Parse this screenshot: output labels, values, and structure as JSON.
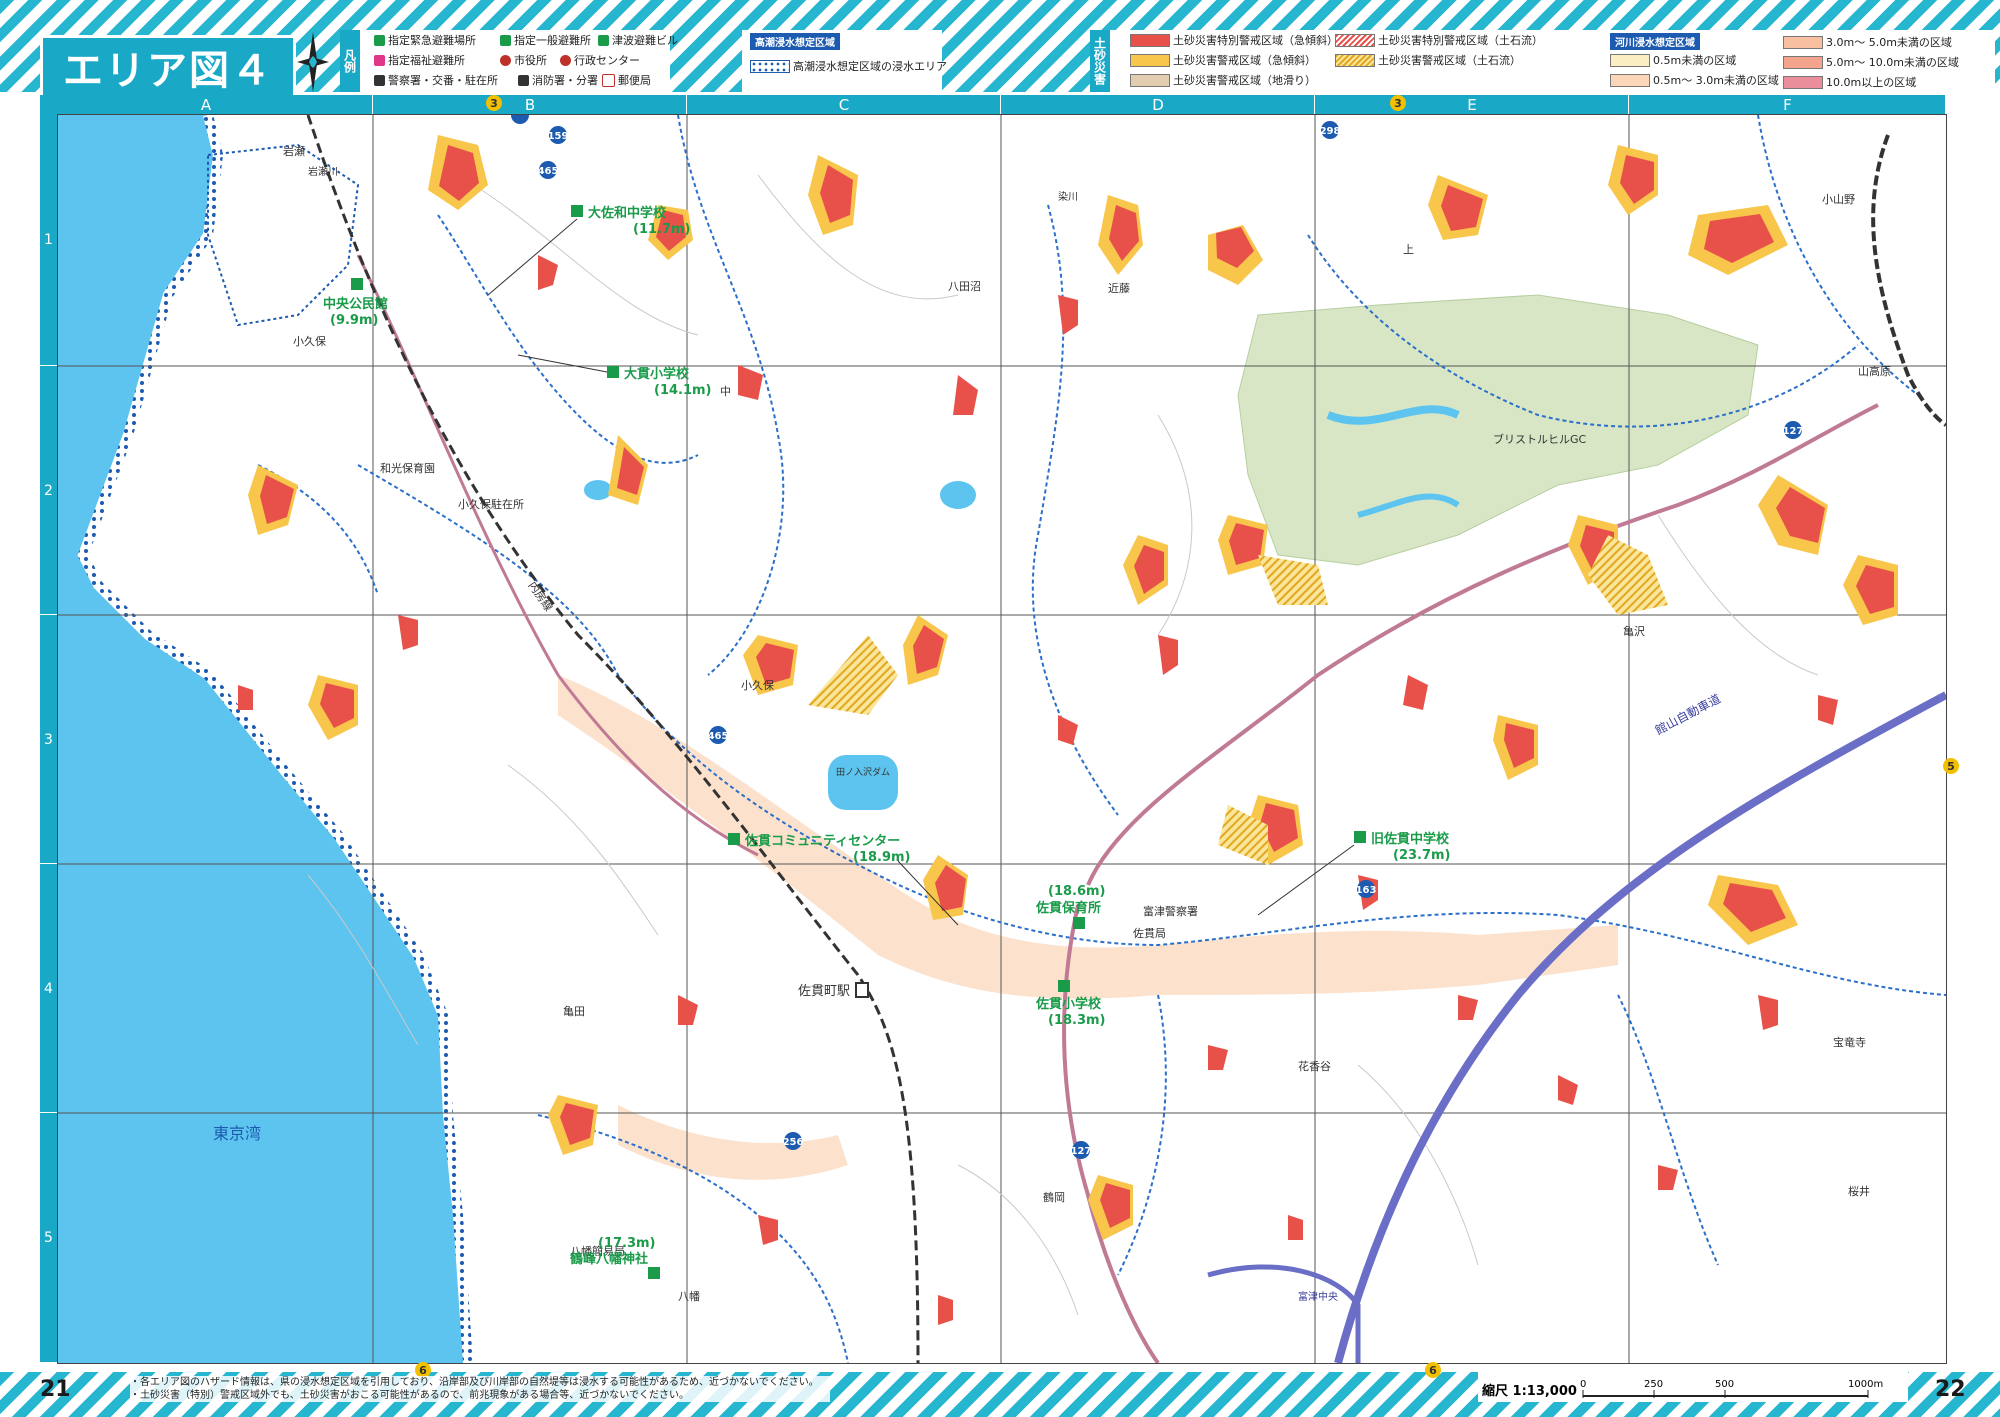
{
  "header": {
    "title": "エリア図４"
  },
  "legend": {
    "shelter_title": "凡例",
    "shelter_items": [
      {
        "label": "指定緊急避難場所",
        "icon": "emergency-shelter-icon"
      },
      {
        "label": "指定一般避難所",
        "icon": "general-shelter-icon"
      },
      {
        "label": "津波避難ビル",
        "icon": "tsunami-building-icon"
      },
      {
        "label": "指定福祉避難所",
        "icon": "welfare-shelter-icon"
      },
      {
        "label": "市役所",
        "icon": "city-hall-icon"
      },
      {
        "label": "行政センター",
        "icon": "admin-center-icon"
      },
      {
        "label": "警察署・交番・駐在所",
        "icon": "police-icon"
      },
      {
        "label": "消防署・分署",
        "icon": "fire-station-icon"
      },
      {
        "label": "郵便局",
        "icon": "post-office-icon"
      }
    ],
    "storm_surge_title": "高潮浸水想定区域",
    "storm_surge_item": "高潮浸水想定区域の浸水エリア",
    "landslide_title": "土砂災害",
    "landslide_items": [
      {
        "label": "土砂災害特別警戒区域（急傾斜）",
        "color": "#e8514a"
      },
      {
        "label": "土砂災害特別警戒区域（土石流）",
        "color": "#e8514a",
        "hatched": true
      },
      {
        "label": "土砂災害警戒区域（急傾斜）",
        "color": "#f7c64a"
      },
      {
        "label": "土砂災害警戒区域（土石流）",
        "color": "#f7c64a",
        "hatched": true
      },
      {
        "label": "土砂災害警戒区域（地滑り）",
        "color": "#e3cdb0"
      }
    ],
    "river_title": "河川浸水想定区域",
    "river_items": [
      {
        "label": "0.5m未満の区域",
        "color": "#fbeec3"
      },
      {
        "label": "0.5m～ 3.0m未満の区域",
        "color": "#fbd6b8"
      },
      {
        "label": "3.0m～ 5.0m未満の区域",
        "color": "#f8c0a0"
      },
      {
        "label": "5.0m～ 10.0m未満の区域",
        "color": "#f4a48c"
      },
      {
        "label": "10.0m以上の区域",
        "color": "#e98e9a"
      }
    ]
  },
  "grid": {
    "columns": [
      "A",
      "B",
      "C",
      "D",
      "E",
      "F"
    ],
    "rows": [
      "1",
      "2",
      "3",
      "4",
      "5"
    ]
  },
  "badges": {
    "top_left": "3",
    "top_right": "3",
    "right": "5",
    "bottom_left": "6",
    "bottom_right": "6"
  },
  "map": {
    "shelters": [
      {
        "name": "大佐和中学校",
        "elev": "(11.7m)"
      },
      {
        "name": "中央公民館",
        "elev": "(9.9m)"
      },
      {
        "name": "大貫小学校",
        "elev": "(14.1m)"
      },
      {
        "name": "佐貫コミュニティセンター",
        "elev": "(18.9m)"
      },
      {
        "name": "旧佐貫中学校",
        "elev": "(23.7m)"
      },
      {
        "name": "佐貫保育所",
        "elev": "(18.6m)"
      },
      {
        "name": "佐貫小学校",
        "elev": "(18.3m)"
      },
      {
        "name": "鶴峰八幡神社",
        "elev": "(17.3m)"
      }
    ],
    "places": [
      "岩瀬",
      "小久保",
      "和光保育園",
      "小久保駐在所",
      "八田沼",
      "近藤",
      "上",
      "小山野",
      "山高原",
      "ブリストルヒルGC",
      "亀沢",
      "小久保",
      "田ノ入沢ダム",
      "宝竜寺",
      "花香谷",
      "亀田",
      "佐貫町駅",
      "富津警察署",
      "佐貫局",
      "鶴岡",
      "桜井",
      "八幡",
      "八幡簡易局",
      "中",
      "岩瀬川",
      "染川",
      "館山自動車道",
      "内房線",
      "東京湾"
    ],
    "routes": [
      "465",
      "159",
      "298",
      "127",
      "163",
      "256",
      "465",
      "127"
    ],
    "interchange": "富津中央"
  },
  "footer": {
    "page_left": "21",
    "page_right": "22",
    "note_1": "・各エリア図のハザード情報は、県の浸水想定区域を引用しており、沿岸部及び川岸部の自然堤等は浸水する可能性があるため、近づかないでください。",
    "note_2": "・土砂災害（特別）警戒区域外でも、土砂災害がおこる可能性があるので、前兆現象がある場合等、近づかないでください。",
    "scale_label": "縮尺 1:13,000",
    "scale_ticks": [
      "0",
      "250",
      "500",
      "1000m"
    ]
  },
  "colors": {
    "accent": "#19a9c7",
    "sea": "#5dc4ef",
    "hazard_red": "#e8514a",
    "hazard_yellow": "#f7c64a",
    "shelter_green": "#1a9b4a"
  }
}
